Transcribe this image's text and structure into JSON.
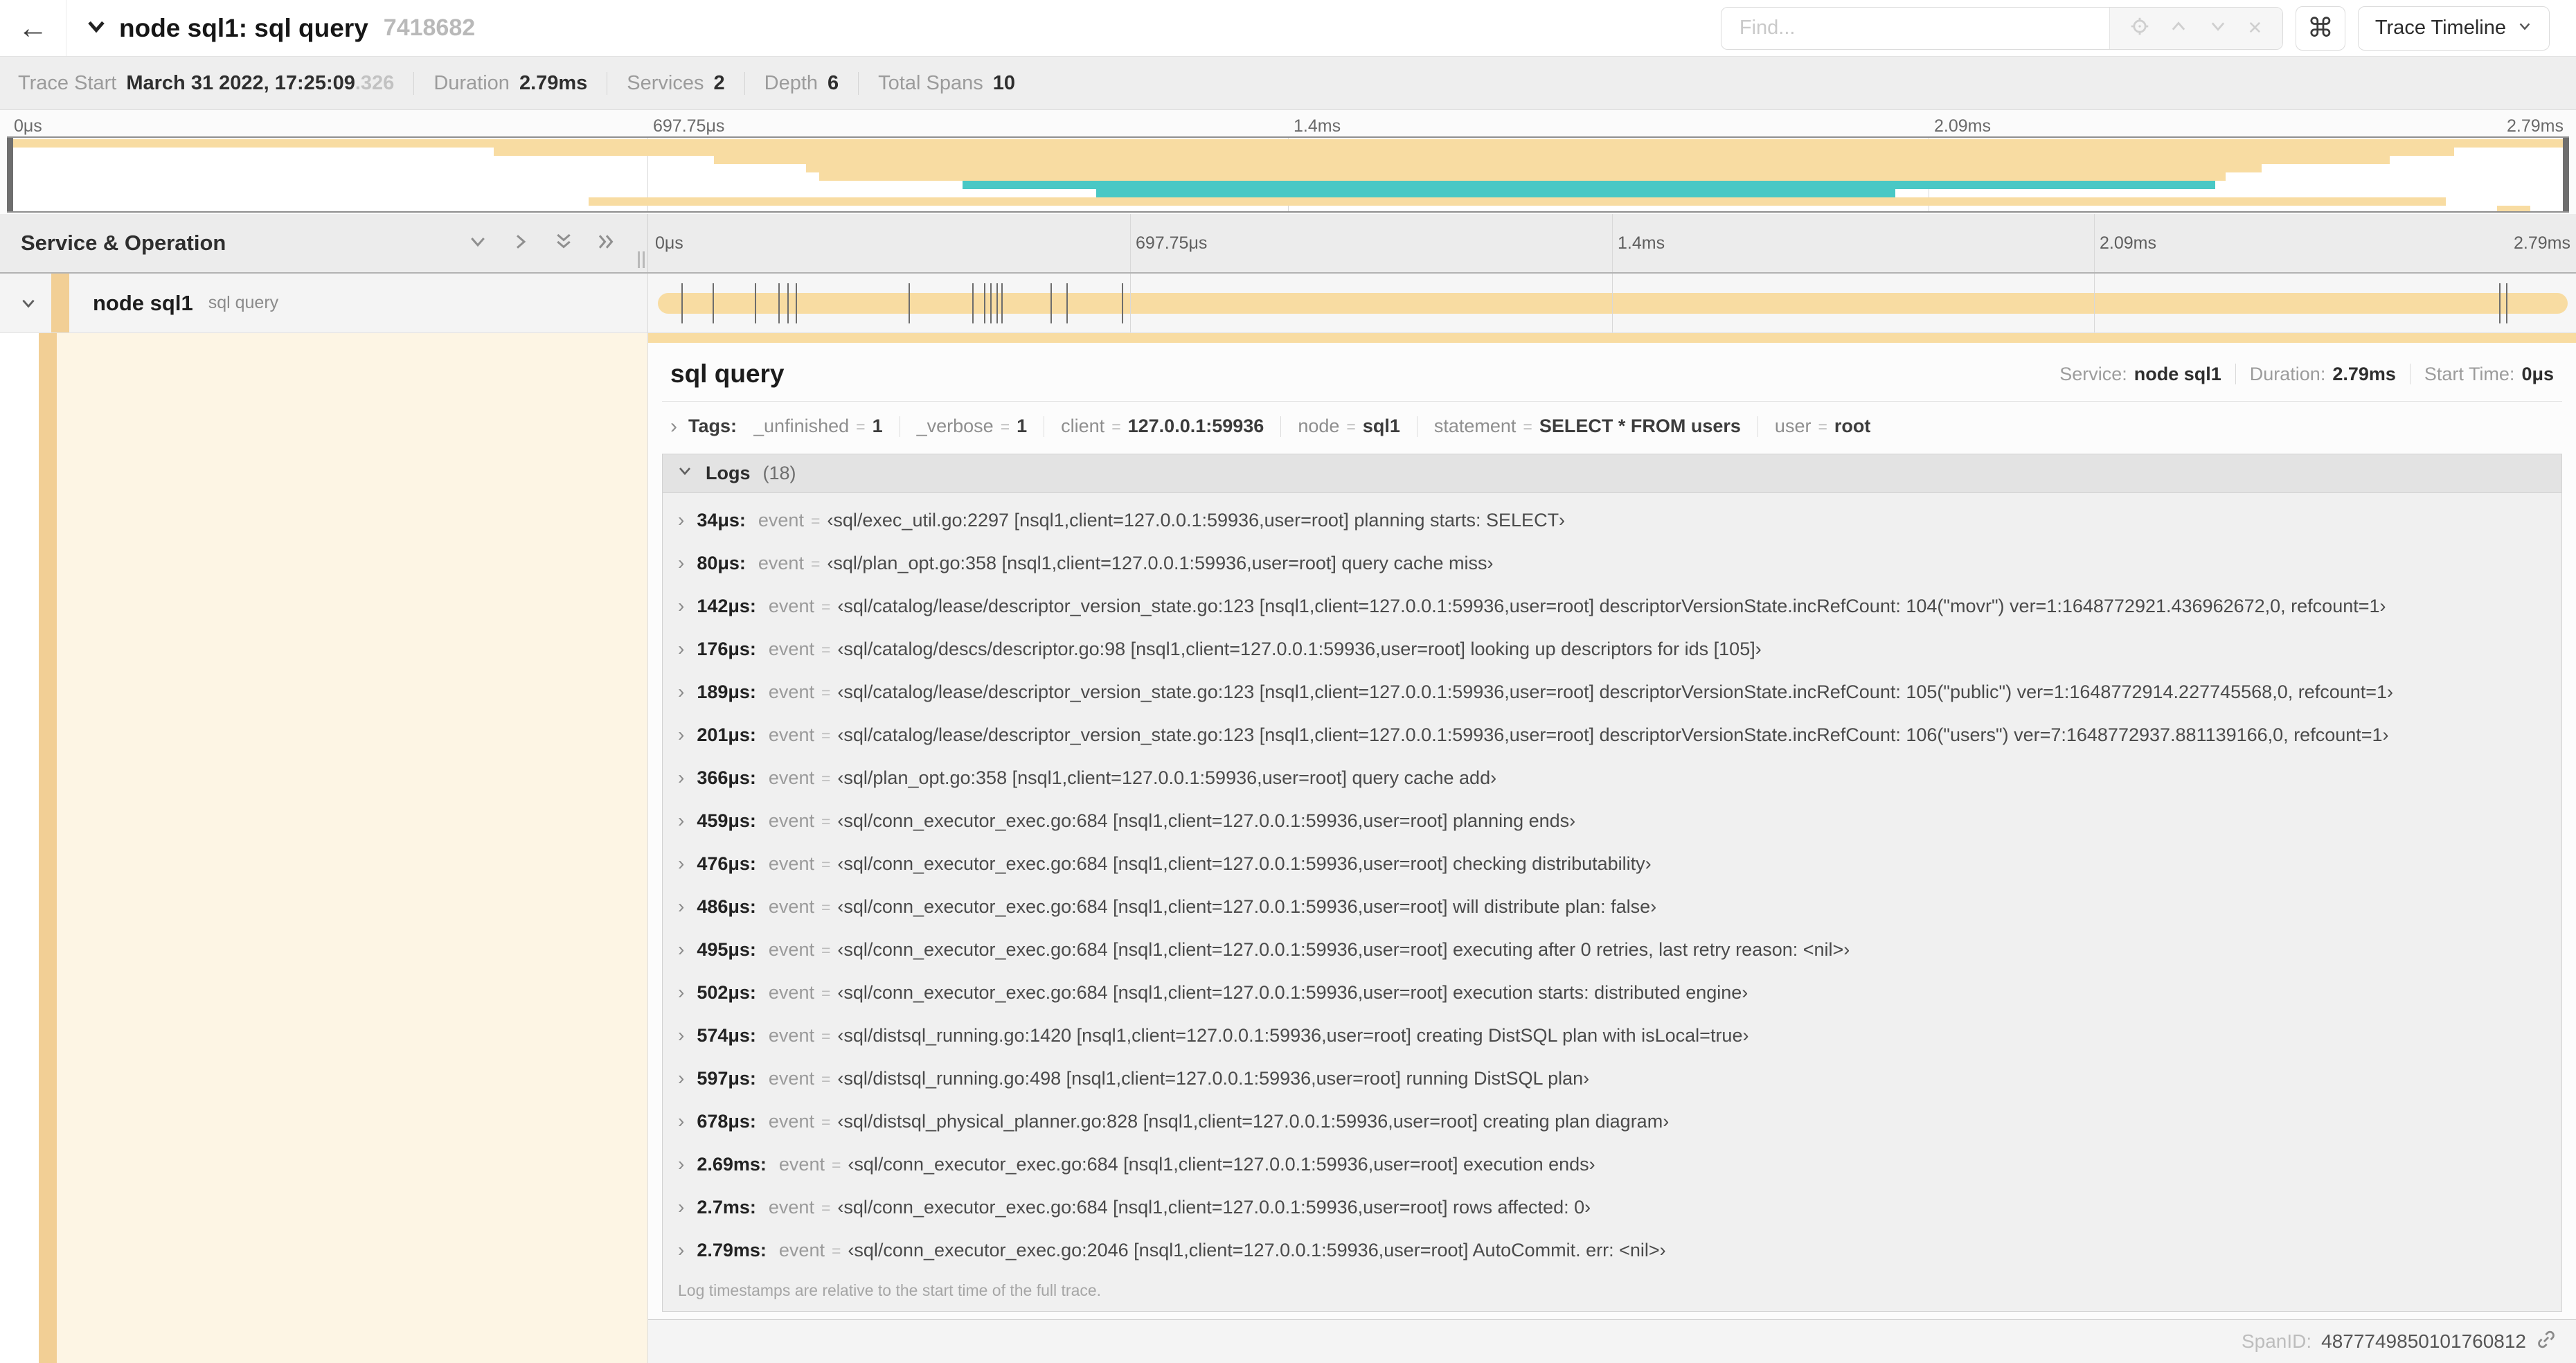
{
  "colors": {
    "tan": "#f8dca2",
    "teal": "#49c8c5",
    "stripe": "#f2cf95",
    "cream": "#fdf5e4"
  },
  "icons": {
    "back_arrow": "←",
    "prev_match": "∧",
    "next_match": "∨",
    "clear_search": "✕",
    "command_key": "⌘",
    "expand": "›"
  },
  "header": {
    "title": "node sql1: sql query",
    "trace_id": "7418682",
    "find_placeholder": "Find...",
    "view_button": "Trace Timeline"
  },
  "stats": [
    {
      "label": "Trace Start",
      "value": "March 31 2022, 17:25:09",
      "muted": ".326"
    },
    {
      "label": "Duration",
      "value": "2.79ms"
    },
    {
      "label": "Services",
      "value": "2"
    },
    {
      "label": "Depth",
      "value": "6"
    },
    {
      "label": "Total Spans",
      "value": "10"
    }
  ],
  "minimap": {
    "spans": [
      {
        "color": "tan",
        "start": 0,
        "end": 1
      },
      {
        "color": "tan",
        "start": 0.19,
        "end": 0.955
      },
      {
        "color": "tan",
        "start": 0.276,
        "end": 0.93
      },
      {
        "color": "tan",
        "start": 0.312,
        "end": 0.88
      },
      {
        "color": "tan",
        "start": 0.317,
        "end": 0.866
      },
      {
        "color": "teal",
        "start": 0.373,
        "end": 0.862
      },
      {
        "color": "teal",
        "start": 0.425,
        "end": 0.737
      },
      {
        "color": "tan",
        "start": 0.227,
        "end": 0.952
      },
      {
        "color": "tan",
        "start": 0.972,
        "end": 0.985
      }
    ]
  },
  "timeline": {
    "panel_title": "Service & Operation",
    "ticks": [
      {
        "label": "0μs",
        "pos": 0
      },
      {
        "label": "697.75μs",
        "pos": 25
      },
      {
        "label": "1.4ms",
        "pos": 50
      },
      {
        "label": "2.09ms",
        "pos": 75
      },
      {
        "label": "2.79ms",
        "pos": 100
      }
    ],
    "total_us": 2790,
    "row": {
      "service": "node sql1",
      "operation": "sql query",
      "bar_start": 0,
      "bar_end": 1,
      "log_markers_us": [
        34,
        80,
        142,
        176,
        189,
        201,
        366,
        459,
        476,
        486,
        495,
        502,
        574,
        597,
        678,
        2690,
        2700
      ]
    }
  },
  "detail": {
    "title": "sql query",
    "meta": [
      {
        "label": "Service:",
        "value": "node sql1"
      },
      {
        "label": "Duration:",
        "value": "2.79ms"
      },
      {
        "label": "Start Time:",
        "value": "0μs"
      }
    ],
    "tags": {
      "label": "Tags:",
      "items": [
        {
          "key": "_unfinished",
          "value": "1"
        },
        {
          "key": "_verbose",
          "value": "1"
        },
        {
          "key": "client",
          "value": "127.0.0.1:59936"
        },
        {
          "key": "node",
          "value": "sql1"
        },
        {
          "key": "statement",
          "value": "SELECT * FROM users"
        },
        {
          "key": "user",
          "value": "root"
        }
      ]
    },
    "logs": {
      "label": "Logs",
      "count_display": "(18)",
      "entries": [
        {
          "time": "34μs:",
          "key": "event",
          "value": "‹sql/exec_util.go:2297 [nsql1,client=127.0.0.1:59936,user=root] planning starts: SELECT›"
        },
        {
          "time": "80μs:",
          "key": "event",
          "value": "‹sql/plan_opt.go:358 [nsql1,client=127.0.0.1:59936,user=root] query cache miss›"
        },
        {
          "time": "142μs:",
          "key": "event",
          "value": "‹sql/catalog/lease/descriptor_version_state.go:123 [nsql1,client=127.0.0.1:59936,user=root] descriptorVersionState.incRefCount: 104(\"movr\") ver=1:1648772921.436962672,0, refcount=1›"
        },
        {
          "time": "176μs:",
          "key": "event",
          "value": "‹sql/catalog/descs/descriptor.go:98 [nsql1,client=127.0.0.1:59936,user=root] looking up descriptors for ids [105]›"
        },
        {
          "time": "189μs:",
          "key": "event",
          "value": "‹sql/catalog/lease/descriptor_version_state.go:123 [nsql1,client=127.0.0.1:59936,user=root] descriptorVersionState.incRefCount: 105(\"public\") ver=1:1648772914.227745568,0, refcount=1›"
        },
        {
          "time": "201μs:",
          "key": "event",
          "value": "‹sql/catalog/lease/descriptor_version_state.go:123 [nsql1,client=127.0.0.1:59936,user=root] descriptorVersionState.incRefCount: 106(\"users\") ver=7:1648772937.881139166,0, refcount=1›"
        },
        {
          "time": "366μs:",
          "key": "event",
          "value": "‹sql/plan_opt.go:358 [nsql1,client=127.0.0.1:59936,user=root] query cache add›"
        },
        {
          "time": "459μs:",
          "key": "event",
          "value": "‹sql/conn_executor_exec.go:684 [nsql1,client=127.0.0.1:59936,user=root] planning ends›"
        },
        {
          "time": "476μs:",
          "key": "event",
          "value": "‹sql/conn_executor_exec.go:684 [nsql1,client=127.0.0.1:59936,user=root] checking distributability›"
        },
        {
          "time": "486μs:",
          "key": "event",
          "value": "‹sql/conn_executor_exec.go:684 [nsql1,client=127.0.0.1:59936,user=root] will distribute plan: false›"
        },
        {
          "time": "495μs:",
          "key": "event",
          "value": "‹sql/conn_executor_exec.go:684 [nsql1,client=127.0.0.1:59936,user=root] executing after 0 retries, last retry reason: <nil>›"
        },
        {
          "time": "502μs:",
          "key": "event",
          "value": "‹sql/conn_executor_exec.go:684 [nsql1,client=127.0.0.1:59936,user=root] execution starts: distributed engine›"
        },
        {
          "time": "574μs:",
          "key": "event",
          "value": "‹sql/distsql_running.go:1420 [nsql1,client=127.0.0.1:59936,user=root] creating DistSQL plan with isLocal=true›"
        },
        {
          "time": "597μs:",
          "key": "event",
          "value": "‹sql/distsql_running.go:498 [nsql1,client=127.0.0.1:59936,user=root] running DistSQL plan›"
        },
        {
          "time": "678μs:",
          "key": "event",
          "value": "‹sql/distsql_physical_planner.go:828 [nsql1,client=127.0.0.1:59936,user=root] creating plan diagram›"
        },
        {
          "time": "2.69ms:",
          "key": "event",
          "value": "‹sql/conn_executor_exec.go:684 [nsql1,client=127.0.0.1:59936,user=root] execution ends›"
        },
        {
          "time": "2.7ms:",
          "key": "event",
          "value": "‹sql/conn_executor_exec.go:684 [nsql1,client=127.0.0.1:59936,user=root] rows affected: 0›"
        },
        {
          "time": "2.79ms:",
          "key": "event",
          "value": "‹sql/conn_executor_exec.go:2046 [nsql1,client=127.0.0.1:59936,user=root] AutoCommit. err: <nil>›"
        }
      ],
      "footnote": "Log timestamps are relative to the start time of the full trace."
    },
    "span_id_label": "SpanID:",
    "span_id": "4877749850101760812"
  }
}
